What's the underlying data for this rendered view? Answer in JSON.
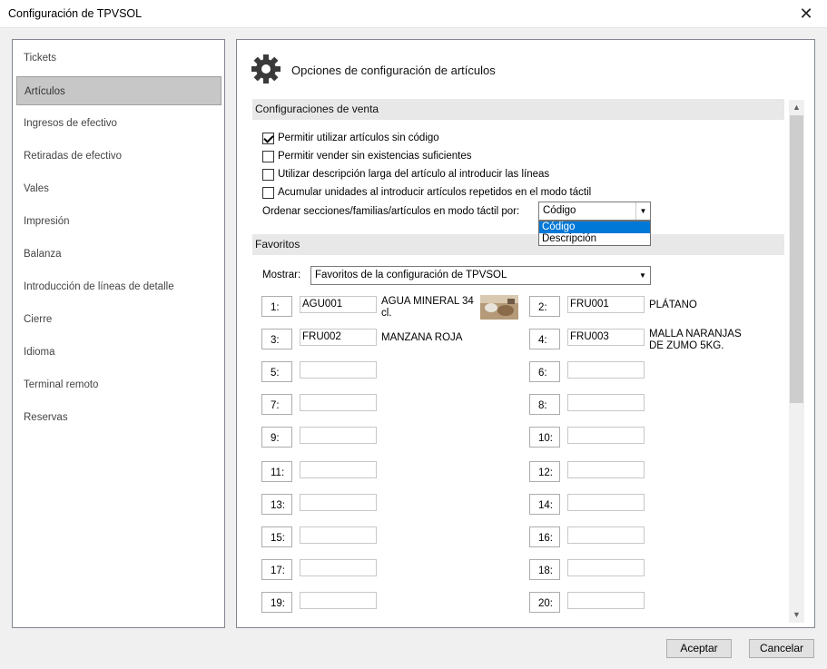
{
  "window": {
    "title": "Configuración de TPVSOL",
    "close_glyph": "✕"
  },
  "sidebar": {
    "items": [
      {
        "label": "Tickets"
      },
      {
        "label": "Artículos"
      },
      {
        "label": "Ingresos de efectivo"
      },
      {
        "label": "Retiradas de efectivo"
      },
      {
        "label": "Vales"
      },
      {
        "label": "Impresión"
      },
      {
        "label": "Balanza"
      },
      {
        "label": "Introducción de líneas de detalle"
      },
      {
        "label": "Cierre"
      },
      {
        "label": "Idioma"
      },
      {
        "label": "Terminal remoto"
      },
      {
        "label": "Reservas"
      }
    ],
    "selected_index": 1
  },
  "panel": {
    "title": "Opciones de configuración de artículos",
    "icon": "gear-icon"
  },
  "venta": {
    "section_title": "Configuraciones de venta",
    "checkboxes": [
      {
        "label": "Permitir utilizar artículos sin código",
        "checked": true
      },
      {
        "label": "Permitir vender sin existencias suficientes",
        "checked": false
      },
      {
        "label": "Utilizar descripción larga del artículo al introducir las líneas",
        "checked": false
      },
      {
        "label": "Acumular unidades al introducir artículos repetidos en el modo táctil",
        "checked": false
      }
    ],
    "order_label": "Ordenar secciones/familias/artículos en modo táctil por:",
    "order_value": "Código",
    "order_options": [
      "Código",
      "Descripción"
    ],
    "order_highlighted": "Código"
  },
  "favoritos": {
    "section_title": "Favoritos",
    "mostrar_label": "Mostrar:",
    "mostrar_value": "Favoritos de la configuración de TPVSOL",
    "slots": [
      {
        "n": "1:",
        "code": "AGU001",
        "desc": "AGUA MINERAL 34 cl.",
        "has_image": true
      },
      {
        "n": "2:",
        "code": "FRU001",
        "desc": "PLÁTANO"
      },
      {
        "n": "3:",
        "code": "FRU002",
        "desc": "MANZANA ROJA"
      },
      {
        "n": "4:",
        "code": "FRU003",
        "desc": "MALLA NARANJAS DE ZUMO 5KG."
      },
      {
        "n": "5:",
        "code": "",
        "desc": ""
      },
      {
        "n": "6:",
        "code": "",
        "desc": ""
      },
      {
        "n": "7:",
        "code": "",
        "desc": ""
      },
      {
        "n": "8:",
        "code": "",
        "desc": ""
      },
      {
        "n": "9:",
        "code": "",
        "desc": ""
      },
      {
        "n": "10:",
        "code": "",
        "desc": ""
      },
      {
        "n": "11:",
        "code": "",
        "desc": ""
      },
      {
        "n": "12:",
        "code": "",
        "desc": ""
      },
      {
        "n": "13:",
        "code": "",
        "desc": ""
      },
      {
        "n": "14:",
        "code": "",
        "desc": ""
      },
      {
        "n": "15:",
        "code": "",
        "desc": ""
      },
      {
        "n": "16:",
        "code": "",
        "desc": ""
      },
      {
        "n": "17:",
        "code": "",
        "desc": ""
      },
      {
        "n": "18:",
        "code": "",
        "desc": ""
      },
      {
        "n": "19:",
        "code": "",
        "desc": ""
      },
      {
        "n": "20:",
        "code": "",
        "desc": ""
      }
    ]
  },
  "footer": {
    "accept_label": "Aceptar",
    "cancel_label": "Cancelar"
  },
  "colors": {
    "selection": "#0078d7",
    "sidebar_selected": "#c7c7c7",
    "section_bg": "#e8e8e8"
  }
}
